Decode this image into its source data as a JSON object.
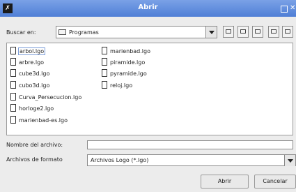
{
  "window": {
    "title": "Abrir",
    "app_icon": "✗"
  },
  "look_in": {
    "label": "Buscar en:",
    "value": "Programas"
  },
  "toolbar": {
    "icons": [
      "up-folder-icon",
      "home-icon",
      "new-folder-icon",
      "list-view-icon",
      "details-view-icon"
    ]
  },
  "files": [
    "arbol.lgo",
    "arbre.lgo",
    "cube3d.lgo",
    "cubo3d.lgo",
    "Curva_Persecucion.lgo",
    "horloge2.lgo",
    "marienbad-es.lgo",
    "marienbad.lgo",
    "piramide.lgo",
    "pyramide.lgo",
    "reloj.lgo"
  ],
  "filename": {
    "label": "Nombre del archivo:",
    "value": ""
  },
  "filetype": {
    "label": "Archivos de formato",
    "value": "Archivos Logo (*.lgo)"
  },
  "buttons": {
    "open": "Abrir",
    "cancel": "Cancelar"
  }
}
